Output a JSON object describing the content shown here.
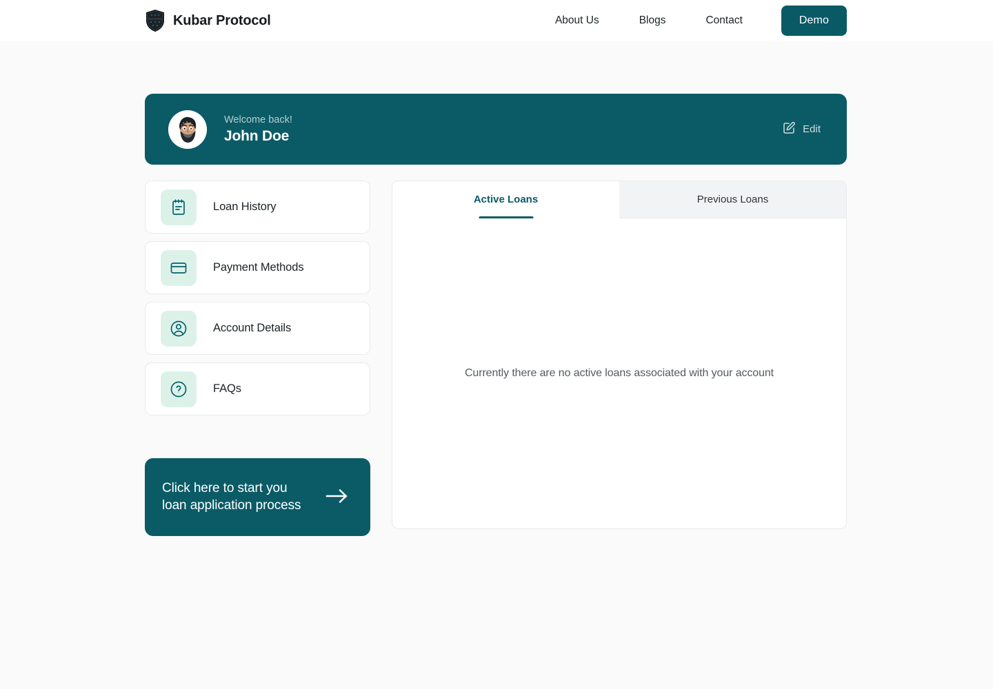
{
  "header": {
    "brand_name": "Kubar Protocol",
    "logo_icon": "shield-icon",
    "nav": [
      {
        "label": "About Us",
        "name": "about-us"
      },
      {
        "label": "Blogs",
        "name": "blogs"
      },
      {
        "label": "Contact",
        "name": "contact"
      }
    ],
    "cta_label": "Demo"
  },
  "welcome": {
    "greeting": "Welcome back!",
    "user_name": "John Doe",
    "avatar_icon": "user-avatar",
    "edit_label": "Edit",
    "edit_icon": "pencil-edit-icon"
  },
  "sidebar": {
    "items": [
      {
        "label": "Loan History",
        "icon": "clipboard-icon"
      },
      {
        "label": "Payment Methods",
        "icon": "credit-card-icon"
      },
      {
        "label": "Account Details",
        "icon": "user-circle-icon"
      },
      {
        "label": "FAQs",
        "icon": "question-circle-icon"
      }
    ],
    "cta": {
      "line1": "Click here to start you",
      "line2": "loan application process",
      "icon": "arrow-right-icon"
    }
  },
  "panel": {
    "tabs": [
      {
        "label": "Active Loans",
        "active": true
      },
      {
        "label": "Previous Loans",
        "active": false
      }
    ],
    "empty_message": "Currently there are no active loans associated with your account"
  },
  "colors": {
    "teal": "#0b5b66",
    "mint": "#dcf2e9",
    "page_bg": "#fafafa",
    "card_border": "#e9eaeb",
    "inactive_tab_bg": "#f2f3f4"
  }
}
